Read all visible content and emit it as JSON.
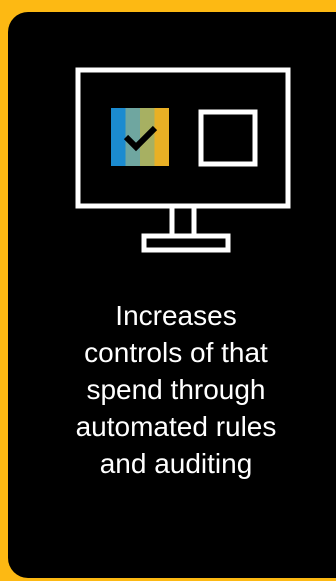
{
  "card": {
    "caption": "Increases\ncontrols of that\nspend through\nautomated rules\nand auditing"
  },
  "colors": {
    "background_accent": "#FDB913",
    "card_background": "#000000",
    "line_art": "#FFFFFF",
    "check_tile_stripes": [
      "#1B8BD0",
      "#6FA6A0",
      "#A7B062",
      "#E9B025"
    ]
  },
  "icons": [
    "monitor-icon",
    "checked-box-icon",
    "empty-box-icon"
  ]
}
